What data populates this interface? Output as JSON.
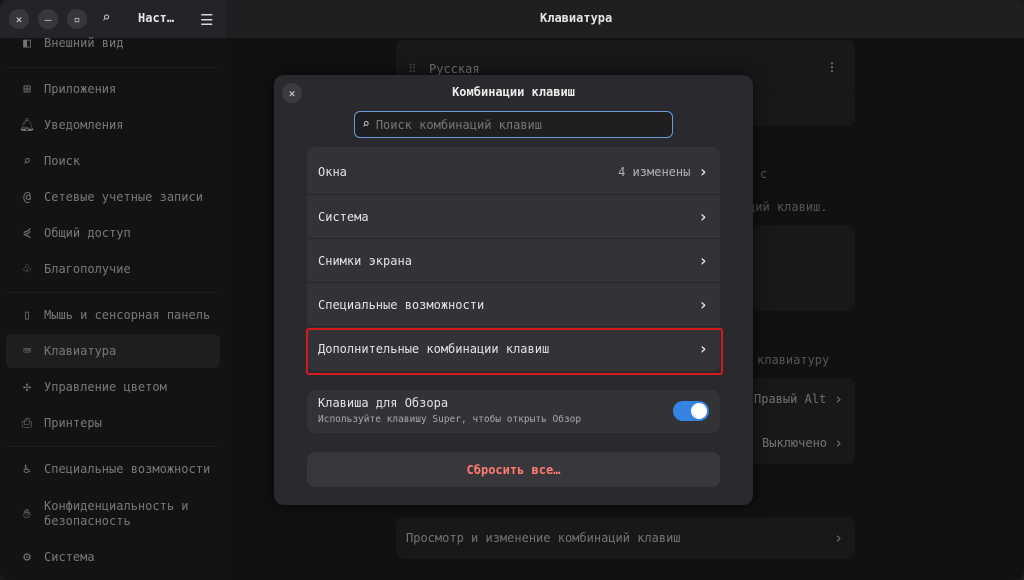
{
  "titlebar": {
    "sidebar_title": "Наст…",
    "main_title": "Клавиатура"
  },
  "sidebar": {
    "items": [
      {
        "label": "Внешний вид",
        "icon": "appearance-icon"
      },
      {
        "label": "Приложения",
        "icon": "apps-icon"
      },
      {
        "label": "Уведомления",
        "icon": "bell-icon"
      },
      {
        "label": "Поиск",
        "icon": "search-icon"
      },
      {
        "label": "Сетевые учетные записи",
        "icon": "at-icon"
      },
      {
        "label": "Общий доступ",
        "icon": "share-icon"
      },
      {
        "label": "Благополучие",
        "icon": "wellbeing-icon"
      },
      {
        "label": "Мышь и сенсорная панель",
        "icon": "mouse-icon"
      },
      {
        "label": "Клавиатура",
        "icon": "keyboard-icon"
      },
      {
        "label": "Управление цветом",
        "icon": "palette-icon"
      },
      {
        "label": "Принтеры",
        "icon": "printer-icon"
      },
      {
        "label": "Специальные возможности",
        "icon": "accessibility-icon"
      },
      {
        "label": "Конфиденциальность и безопасность",
        "icon": "hand-icon"
      },
      {
        "label": "Система",
        "icon": "gear-icon"
      }
    ]
  },
  "background": {
    "input_source": "Русская",
    "frag_1": "с",
    "frag_2": "ций клавиш.",
    "frag_3": "клавиатуру",
    "alt_value": "Правый Alt",
    "compose_value": "Выключено",
    "view_shortcuts": "Просмотр и изменение комбинаций клавиш"
  },
  "dialog": {
    "title": "Комбинации клавиш",
    "search_placeholder": "Поиск комбинаций клавиш",
    "rows": [
      {
        "label": "Окна",
        "value": "4 изменены"
      },
      {
        "label": "Система",
        "value": ""
      },
      {
        "label": "Снимки экрана",
        "value": ""
      },
      {
        "label": "Специальные возможности",
        "value": ""
      },
      {
        "label": "Дополнительные комбинации клавиш",
        "value": ""
      }
    ],
    "overview_key": {
      "title": "Клавиша для Обзора",
      "subtitle": "Используйте клавишу Super, чтобы открыть Обзор",
      "enabled": true
    },
    "reset_label": "Сбросить все…"
  },
  "colors": {
    "accent": "#3584e4",
    "destructive": "#ff7b72",
    "highlight_border": "#d01c1c"
  }
}
